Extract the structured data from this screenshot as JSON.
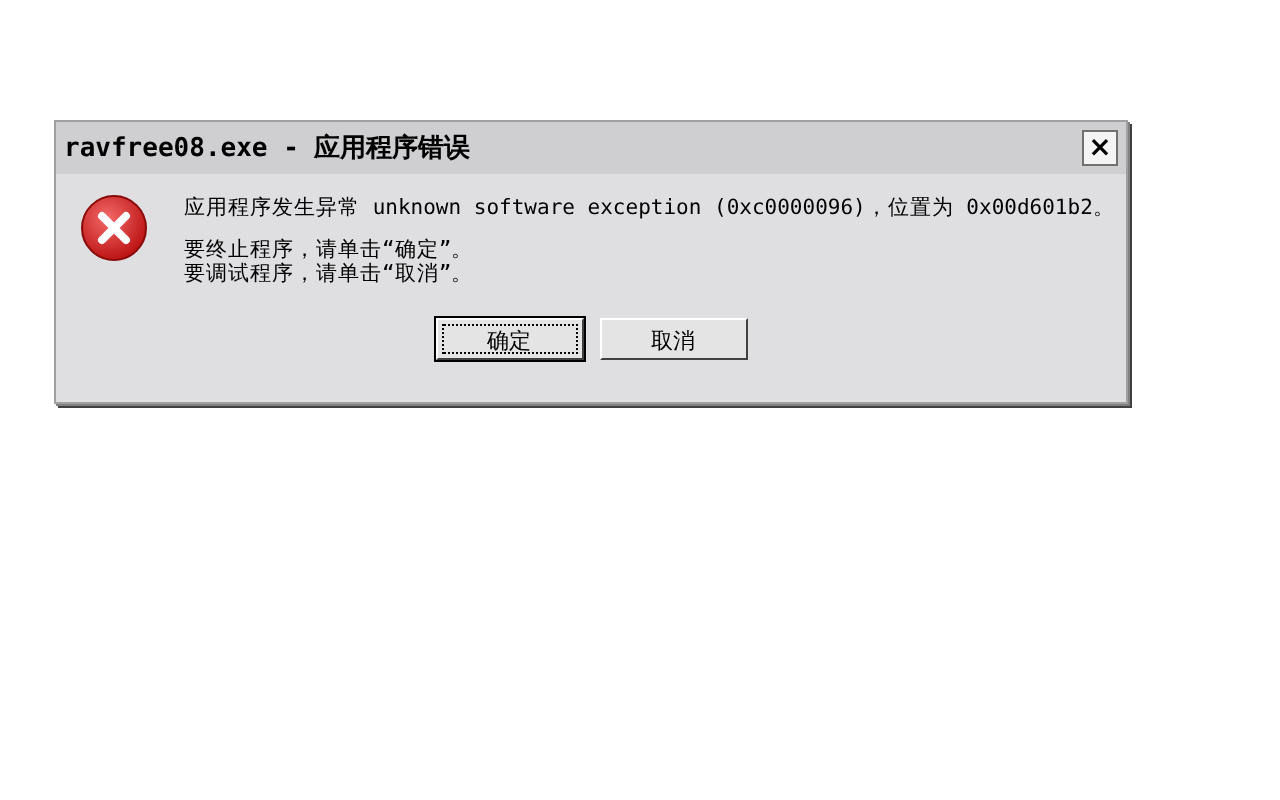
{
  "window": {
    "title": "ravfree08.exe - 应用程序错误",
    "close": "×"
  },
  "message": {
    "lines": [
      "应用程序发生异常 unknown software exception (0xc0000096)，位置为 0x00d601b2。",
      "要终止程序，请单击“确定”。",
      "要调试程序，请单击“取消”。"
    ]
  },
  "buttons": [
    {
      "label": "确定",
      "default": true
    },
    {
      "label": "取消",
      "default": false
    }
  ]
}
